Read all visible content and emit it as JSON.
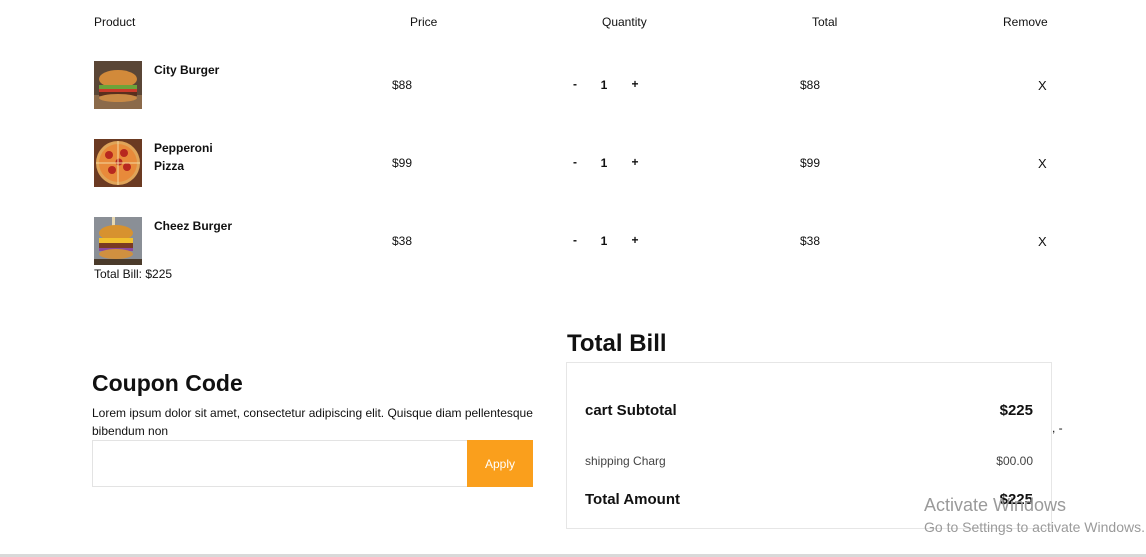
{
  "table": {
    "headers": {
      "product": "Product",
      "price": "Price",
      "quantity": "Quantity",
      "total": "Total",
      "remove": "Remove"
    },
    "rows": [
      {
        "name_line1": "City Burger",
        "name_line2": "",
        "price": "$88",
        "qty": "1",
        "total": "$88",
        "minus": "-",
        "plus": "+",
        "remove": "X",
        "image": "burger-image"
      },
      {
        "name_line1": "Pepperoni",
        "name_line2": "Pizza",
        "price": "$99",
        "qty": "1",
        "total": "$99",
        "minus": "-",
        "plus": "+",
        "remove": "X",
        "image": "pizza-image"
      },
      {
        "name_line1": "Cheez Burger",
        "name_line2": "",
        "price": "$38",
        "qty": "1",
        "total": "$38",
        "minus": "-",
        "plus": "+",
        "remove": "X",
        "image": "cheese-burger-image"
      }
    ],
    "total_bill_text": "Total Bill: $225"
  },
  "coupon": {
    "title": "Coupon Code",
    "description": "Lorem ipsum dolor sit amet, consectetur adipiscing elit. Quisque diam pellentesque bibendum non",
    "input_value": "",
    "apply_label": "Apply",
    "accent_color": "#fa9f1c"
  },
  "bill": {
    "title": "Total Bill",
    "subtotal_label": "cart Subtotal",
    "subtotal_value": "$225",
    "shipping_label": "shipping Charg",
    "shipping_value": "$00.00",
    "total_label": "Total Amount",
    "total_value": "$225",
    "stray_mark": ", -"
  },
  "watermark": {
    "line1": "Activate Windows",
    "line2": "Go to Settings to activate Windows."
  }
}
